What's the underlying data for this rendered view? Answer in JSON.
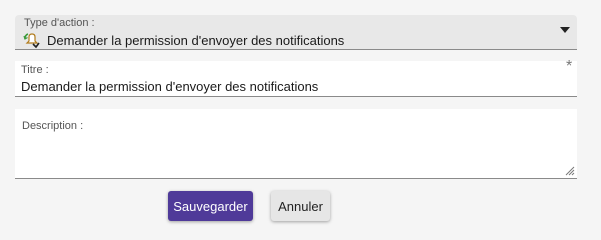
{
  "form": {
    "action_type": {
      "label": "Type d'action :",
      "value": "Demander la permission d'envoyer des notifications",
      "icon": "notification-permission-icon"
    },
    "title_field": {
      "label": "Titre :",
      "value": "Demander la permission d'envoyer des notifications",
      "required_marker": "*"
    },
    "description_field": {
      "label": "Description :",
      "value": ""
    },
    "buttons": {
      "save_label": "Sauvegarder",
      "cancel_label": "Annuler"
    }
  },
  "colors": {
    "primary_button": "#4f3a99",
    "background": "#f5f5f5"
  }
}
